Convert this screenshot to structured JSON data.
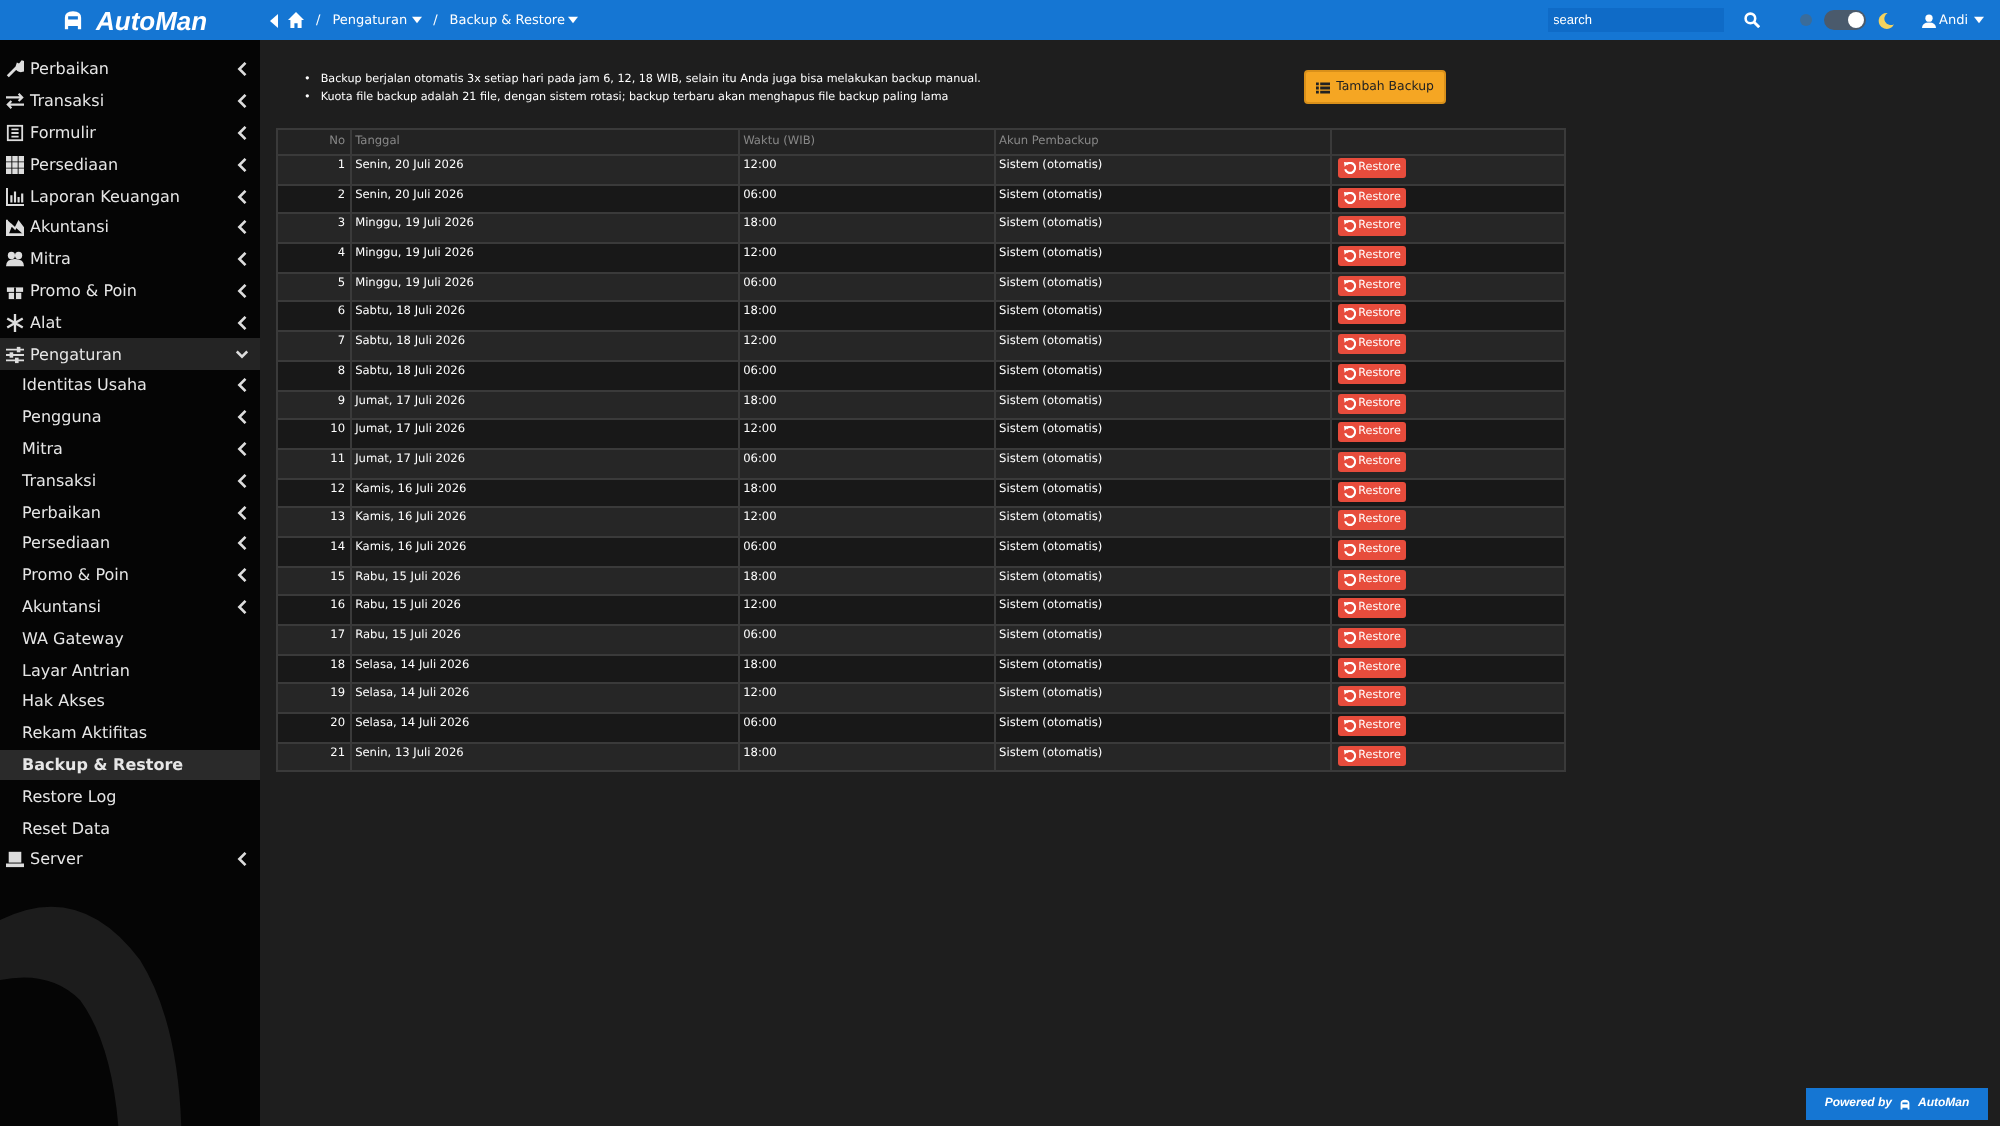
{
  "header": {
    "logo": "AutoMan",
    "breadcrumbs": [
      {
        "separator": "/",
        "label": "Pengaturan",
        "dropdown": true
      },
      {
        "separator": "/",
        "label": "Backup & Restore",
        "dropdown": true
      }
    ],
    "search": {
      "placeholder": "search"
    },
    "dark_mode": true,
    "user": "Andi"
  },
  "sidebar": {
    "items": [
      {
        "label": "Perbaikan",
        "expanded": false,
        "has_children": true
      },
      {
        "label": "Transaksi",
        "expanded": false,
        "has_children": true
      },
      {
        "label": "Formulir",
        "expanded": false,
        "has_children": true
      },
      {
        "label": "Persediaan",
        "expanded": false,
        "has_children": true
      },
      {
        "label": "Laporan Keuangan",
        "expanded": false,
        "has_children": true
      },
      {
        "label": "Akuntansi",
        "expanded": false,
        "has_children": true
      },
      {
        "label": "Mitra",
        "expanded": false,
        "has_children": true
      },
      {
        "label": "Promo & Poin",
        "expanded": false,
        "has_children": true
      },
      {
        "label": "Alat",
        "expanded": false,
        "has_children": true
      },
      {
        "label": "Pengaturan",
        "expanded": true,
        "has_children": true,
        "children": [
          {
            "label": "Identitas Usaha",
            "selected": false,
            "has_children": true
          },
          {
            "label": "Pengguna",
            "selected": false,
            "has_children": true
          },
          {
            "label": "Mitra",
            "selected": false,
            "has_children": true
          },
          {
            "label": "Transaksi",
            "selected": false,
            "has_children": true
          },
          {
            "label": "Perbaikan",
            "selected": false,
            "has_children": true
          },
          {
            "label": "Persediaan",
            "selected": false,
            "has_children": true
          },
          {
            "label": "Promo & Poin",
            "selected": false,
            "has_children": true
          },
          {
            "label": "Akuntansi",
            "selected": false,
            "has_children": true
          },
          {
            "label": "WA Gateway",
            "selected": false,
            "has_children": false
          },
          {
            "label": "Layar Antrian",
            "selected": false,
            "has_children": false
          },
          {
            "label": "Hak Akses",
            "selected": false,
            "has_children": false
          },
          {
            "label": "Rekam Aktifitas",
            "selected": false,
            "has_children": false
          },
          {
            "label": "Backup & Restore",
            "selected": true,
            "has_children": false
          },
          {
            "label": "Restore Log",
            "selected": false,
            "has_children": false
          },
          {
            "label": "Reset Data",
            "selected": false,
            "has_children": false
          }
        ]
      },
      {
        "label": "Server",
        "expanded": false,
        "has_children": true
      }
    ]
  },
  "notes": [
    {
      "bullet": "•",
      "text": "Backup berjalan otomatis 3x setiap hari pada jam 6, 12, 18 WIB, selain itu Anda juga bisa melakukan backup manual."
    },
    {
      "bullet": "•",
      "text": "Kuota file backup adalah 21 file, dengan sistem rotasi; backup terbaru akan menghapus file backup paling lama"
    }
  ],
  "add_button": "Tambah Backup",
  "table": {
    "columns": [
      "No",
      "Tanggal",
      "Waktu (WIB)",
      "Akun Pembackup"
    ],
    "rows": [
      {
        "no": "1",
        "date": "Senin, 20 Juli 2026",
        "time": "12:00",
        "account": "Sistem (otomatis)",
        "action": "Restore"
      },
      {
        "no": "2",
        "date": "Senin, 20 Juli 2026",
        "time": "06:00",
        "account": "Sistem (otomatis)",
        "action": "Restore"
      },
      {
        "no": "3",
        "date": "Minggu, 19 Juli 2026",
        "time": "18:00",
        "account": "Sistem (otomatis)",
        "action": "Restore"
      },
      {
        "no": "4",
        "date": "Minggu, 19 Juli 2026",
        "time": "12:00",
        "account": "Sistem (otomatis)",
        "action": "Restore"
      },
      {
        "no": "5",
        "date": "Minggu, 19 Juli 2026",
        "time": "06:00",
        "account": "Sistem (otomatis)",
        "action": "Restore"
      },
      {
        "no": "6",
        "date": "Sabtu, 18 Juli 2026",
        "time": "18:00",
        "account": "Sistem (otomatis)",
        "action": "Restore"
      },
      {
        "no": "7",
        "date": "Sabtu, 18 Juli 2026",
        "time": "12:00",
        "account": "Sistem (otomatis)",
        "action": "Restore"
      },
      {
        "no": "8",
        "date": "Sabtu, 18 Juli 2026",
        "time": "06:00",
        "account": "Sistem (otomatis)",
        "action": "Restore"
      },
      {
        "no": "9",
        "date": "Jumat, 17 Juli 2026",
        "time": "18:00",
        "account": "Sistem (otomatis)",
        "action": "Restore"
      },
      {
        "no": "10",
        "date": "Jumat, 17 Juli 2026",
        "time": "12:00",
        "account": "Sistem (otomatis)",
        "action": "Restore"
      },
      {
        "no": "11",
        "date": "Jumat, 17 Juli 2026",
        "time": "06:00",
        "account": "Sistem (otomatis)",
        "action": "Restore"
      },
      {
        "no": "12",
        "date": "Kamis, 16 Juli 2026",
        "time": "18:00",
        "account": "Sistem (otomatis)",
        "action": "Restore"
      },
      {
        "no": "13",
        "date": "Kamis, 16 Juli 2026",
        "time": "12:00",
        "account": "Sistem (otomatis)",
        "action": "Restore"
      },
      {
        "no": "14",
        "date": "Kamis, 16 Juli 2026",
        "time": "06:00",
        "account": "Sistem (otomatis)",
        "action": "Restore"
      },
      {
        "no": "15",
        "date": "Rabu, 15 Juli 2026",
        "time": "18:00",
        "account": "Sistem (otomatis)",
        "action": "Restore"
      },
      {
        "no": "16",
        "date": "Rabu, 15 Juli 2026",
        "time": "12:00",
        "account": "Sistem (otomatis)",
        "action": "Restore"
      },
      {
        "no": "17",
        "date": "Rabu, 15 Juli 2026",
        "time": "06:00",
        "account": "Sistem (otomatis)",
        "action": "Restore"
      },
      {
        "no": "18",
        "date": "Selasa, 14 Juli 2026",
        "time": "18:00",
        "account": "Sistem (otomatis)",
        "action": "Restore"
      },
      {
        "no": "19",
        "date": "Selasa, 14 Juli 2026",
        "time": "12:00",
        "account": "Sistem (otomatis)",
        "action": "Restore"
      },
      {
        "no": "20",
        "date": "Selasa, 14 Juli 2026",
        "time": "06:00",
        "account": "Sistem (otomatis)",
        "action": "Restore"
      },
      {
        "no": "21",
        "date": "Senin, 13 Juli 2026",
        "time": "18:00",
        "account": "Sistem (otomatis)",
        "action": "Restore"
      }
    ]
  },
  "footer": {
    "powered_by": "Powered by",
    "brand": "AutoMan"
  }
}
